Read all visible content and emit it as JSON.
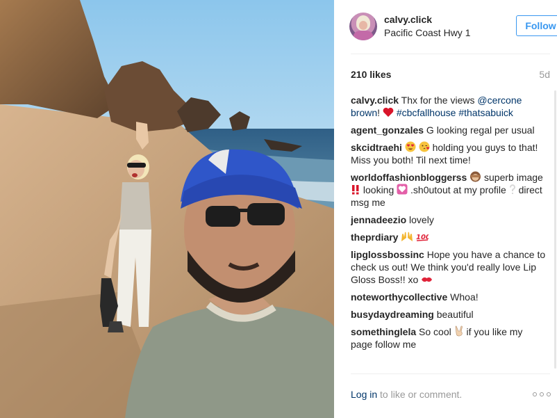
{
  "post": {
    "username": "calvy.click",
    "location": "Pacific Coast Hwy 1",
    "follow_label": "Follow",
    "likes": "210 likes",
    "age": "5d"
  },
  "caption": {
    "user": "calvy.click",
    "text_1": "Thx for the views",
    "mention": "@cercone​brown",
    "text_2": "!",
    "tag_1": "#cbcfallhouse",
    "tag_2": "#thatsabuick"
  },
  "comments": [
    {
      "user": "agent_gonzales",
      "text": "G looking regal per usual"
    },
    {
      "user": "skcidtraehi",
      "text_a": "",
      "text_b": "holding you guys to that! Miss you both! Til next time!"
    },
    {
      "user": "worldoffashionbloggerss",
      "text_a": "superb image",
      "text_b": "looking",
      "text_c": ".sh0utout at my profile",
      "text_d": "direct msg me"
    },
    {
      "user": "jennadeezio",
      "text": "lovely"
    },
    {
      "user": "theprdiary",
      "text": ""
    },
    {
      "user": "lipglossbossinc",
      "text": "Hope you have a chance to check us out! We think you'd really love Lip Gloss Boss!! xo"
    },
    {
      "user": "noteworthycollective",
      "text": "Whoa!"
    },
    {
      "user": "busydaydreaming",
      "text": "beautiful"
    },
    {
      "user": "somethinglela",
      "text_a": "So cool",
      "text_b": "if you like my page follow me"
    }
  ],
  "footer": {
    "login_label": "Log in",
    "rest": " to like or comment."
  },
  "icons": {
    "heart": "heart-emoji",
    "more": "more-options-icon"
  }
}
